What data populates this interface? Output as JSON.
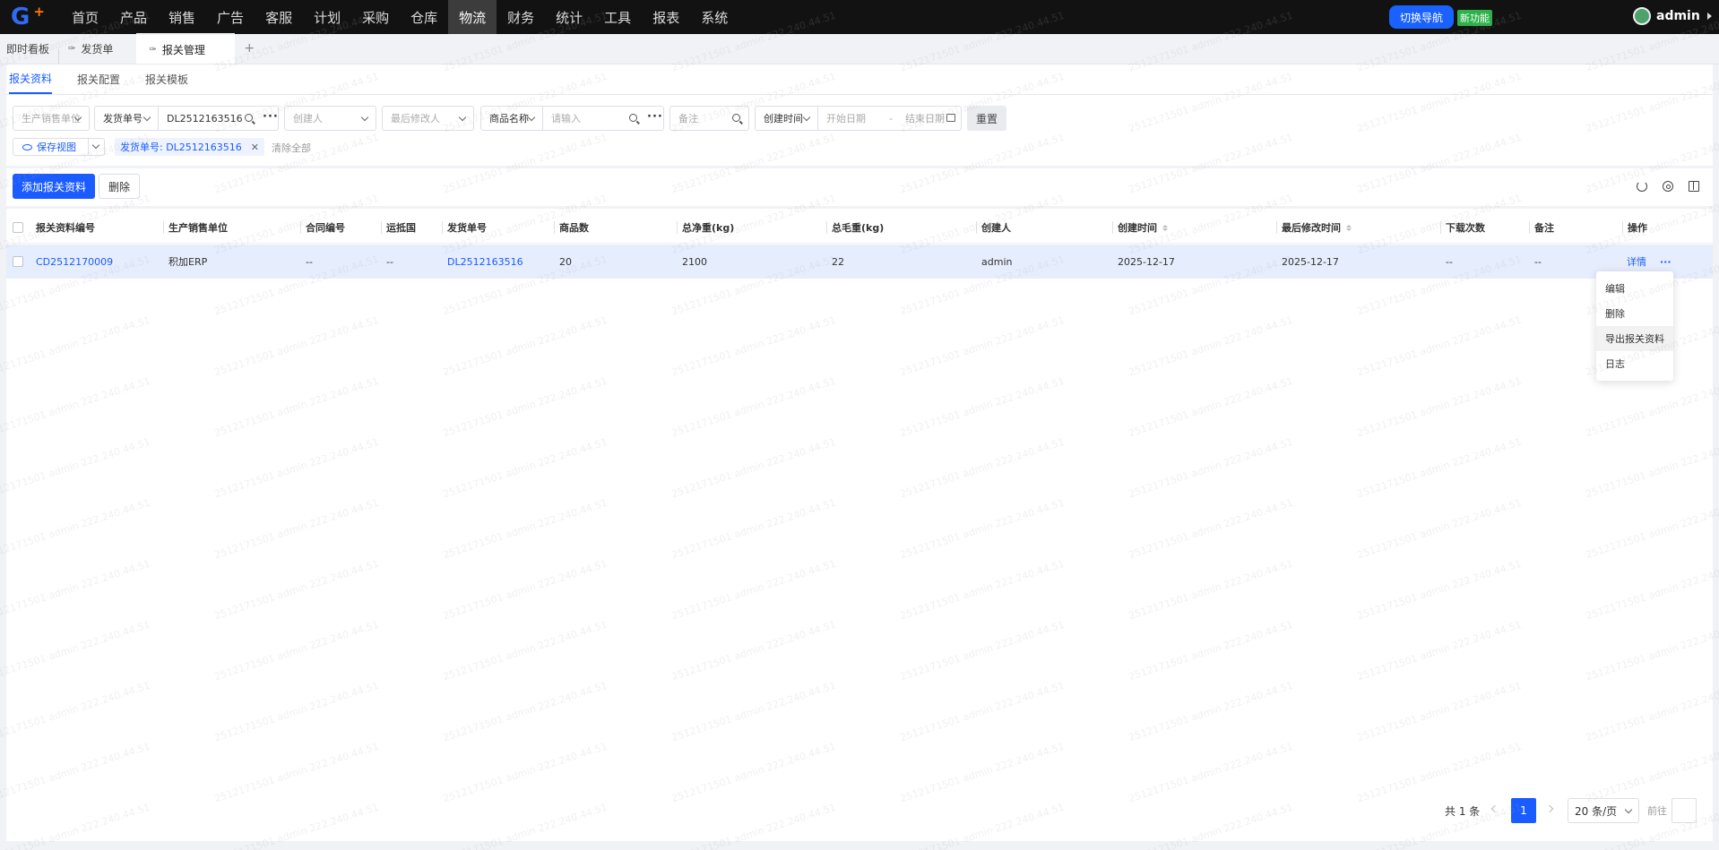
{
  "nav": {
    "items": [
      "首页",
      "产品",
      "销售",
      "广告",
      "客服",
      "计划",
      "采购",
      "仓库",
      "物流",
      "财务",
      "统计",
      "工具",
      "报表",
      "系统"
    ],
    "active_index": 8,
    "switch_nav": "切换导航",
    "new_feature": "新功能",
    "username": "admin"
  },
  "tabs": {
    "dashboard": "即时看板",
    "shipping": "发货单",
    "customs": "报关管理",
    "add": "+"
  },
  "subtabs": [
    "报关资料",
    "报关配置",
    "报关模板"
  ],
  "filters": {
    "unit_placeholder": "生产销售单位",
    "ship_no_label": "发货单号",
    "ship_no_value": "DL2512163516",
    "creator_placeholder": "创建人",
    "modifier_placeholder": "最后修改人",
    "product_label": "商品名称",
    "product_placeholder": "请输入",
    "remark_placeholder": "备注",
    "date_label": "创建时间",
    "start_date": "开始日期",
    "date_sep": "-",
    "end_date": "结束日期",
    "reset": "重置"
  },
  "view": {
    "save_view": "保存视图",
    "chip": "发货单号: DL2512163516",
    "clear_all": "清除全部"
  },
  "actions": {
    "add": "添加报关资料",
    "delete": "删除"
  },
  "table": {
    "headers": [
      "报关资料编号",
      "生产销售单位",
      "合同编号",
      "运抵国",
      "发货单号",
      "商品数",
      "总净重(kg)",
      "总毛重(kg)",
      "创建人",
      "创建时间",
      "最后修改时间",
      "下载次数",
      "备注",
      "操作"
    ],
    "rows": [
      {
        "id": "CD2512170009",
        "unit": "积加ERP",
        "contract": "--",
        "country": "--",
        "ship_no": "DL2512163516",
        "goods": "20",
        "net": "2100",
        "gross": "22",
        "creator": "admin",
        "created": "2025-12-17",
        "modified": "2025-12-17",
        "downloads": "--",
        "remark": "--",
        "detail": "详情",
        "more": "···"
      }
    ]
  },
  "row_menu": [
    "编辑",
    "删除",
    "导出报关资料",
    "日志"
  ],
  "pager": {
    "total": "共 1 条",
    "page": "1",
    "page_size": "20 条/页",
    "goto": "前往"
  },
  "watermark": "2512171501 admin 222.240.44.51",
  "colors": {
    "primary": "#1a5cff",
    "nav_bg": "#121212",
    "green": "#2db14a",
    "row_highlight": "#e6edfd"
  }
}
